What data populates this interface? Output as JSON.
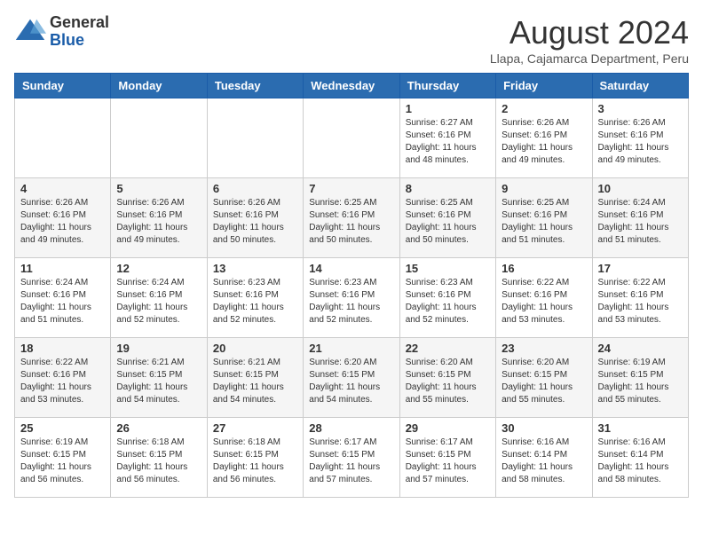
{
  "header": {
    "logo_general": "General",
    "logo_blue": "Blue",
    "month_year": "August 2024",
    "location": "Llapa, Cajamarca Department, Peru"
  },
  "days_of_week": [
    "Sunday",
    "Monday",
    "Tuesday",
    "Wednesday",
    "Thursday",
    "Friday",
    "Saturday"
  ],
  "weeks": [
    [
      {
        "day": "",
        "info": ""
      },
      {
        "day": "",
        "info": ""
      },
      {
        "day": "",
        "info": ""
      },
      {
        "day": "",
        "info": ""
      },
      {
        "day": "1",
        "info": "Sunrise: 6:27 AM\nSunset: 6:16 PM\nDaylight: 11 hours\nand 48 minutes."
      },
      {
        "day": "2",
        "info": "Sunrise: 6:26 AM\nSunset: 6:16 PM\nDaylight: 11 hours\nand 49 minutes."
      },
      {
        "day": "3",
        "info": "Sunrise: 6:26 AM\nSunset: 6:16 PM\nDaylight: 11 hours\nand 49 minutes."
      }
    ],
    [
      {
        "day": "4",
        "info": "Sunrise: 6:26 AM\nSunset: 6:16 PM\nDaylight: 11 hours\nand 49 minutes."
      },
      {
        "day": "5",
        "info": "Sunrise: 6:26 AM\nSunset: 6:16 PM\nDaylight: 11 hours\nand 49 minutes."
      },
      {
        "day": "6",
        "info": "Sunrise: 6:26 AM\nSunset: 6:16 PM\nDaylight: 11 hours\nand 50 minutes."
      },
      {
        "day": "7",
        "info": "Sunrise: 6:25 AM\nSunset: 6:16 PM\nDaylight: 11 hours\nand 50 minutes."
      },
      {
        "day": "8",
        "info": "Sunrise: 6:25 AM\nSunset: 6:16 PM\nDaylight: 11 hours\nand 50 minutes."
      },
      {
        "day": "9",
        "info": "Sunrise: 6:25 AM\nSunset: 6:16 PM\nDaylight: 11 hours\nand 51 minutes."
      },
      {
        "day": "10",
        "info": "Sunrise: 6:24 AM\nSunset: 6:16 PM\nDaylight: 11 hours\nand 51 minutes."
      }
    ],
    [
      {
        "day": "11",
        "info": "Sunrise: 6:24 AM\nSunset: 6:16 PM\nDaylight: 11 hours\nand 51 minutes."
      },
      {
        "day": "12",
        "info": "Sunrise: 6:24 AM\nSunset: 6:16 PM\nDaylight: 11 hours\nand 52 minutes."
      },
      {
        "day": "13",
        "info": "Sunrise: 6:23 AM\nSunset: 6:16 PM\nDaylight: 11 hours\nand 52 minutes."
      },
      {
        "day": "14",
        "info": "Sunrise: 6:23 AM\nSunset: 6:16 PM\nDaylight: 11 hours\nand 52 minutes."
      },
      {
        "day": "15",
        "info": "Sunrise: 6:23 AM\nSunset: 6:16 PM\nDaylight: 11 hours\nand 52 minutes."
      },
      {
        "day": "16",
        "info": "Sunrise: 6:22 AM\nSunset: 6:16 PM\nDaylight: 11 hours\nand 53 minutes."
      },
      {
        "day": "17",
        "info": "Sunrise: 6:22 AM\nSunset: 6:16 PM\nDaylight: 11 hours\nand 53 minutes."
      }
    ],
    [
      {
        "day": "18",
        "info": "Sunrise: 6:22 AM\nSunset: 6:16 PM\nDaylight: 11 hours\nand 53 minutes."
      },
      {
        "day": "19",
        "info": "Sunrise: 6:21 AM\nSunset: 6:15 PM\nDaylight: 11 hours\nand 54 minutes."
      },
      {
        "day": "20",
        "info": "Sunrise: 6:21 AM\nSunset: 6:15 PM\nDaylight: 11 hours\nand 54 minutes."
      },
      {
        "day": "21",
        "info": "Sunrise: 6:20 AM\nSunset: 6:15 PM\nDaylight: 11 hours\nand 54 minutes."
      },
      {
        "day": "22",
        "info": "Sunrise: 6:20 AM\nSunset: 6:15 PM\nDaylight: 11 hours\nand 55 minutes."
      },
      {
        "day": "23",
        "info": "Sunrise: 6:20 AM\nSunset: 6:15 PM\nDaylight: 11 hours\nand 55 minutes."
      },
      {
        "day": "24",
        "info": "Sunrise: 6:19 AM\nSunset: 6:15 PM\nDaylight: 11 hours\nand 55 minutes."
      }
    ],
    [
      {
        "day": "25",
        "info": "Sunrise: 6:19 AM\nSunset: 6:15 PM\nDaylight: 11 hours\nand 56 minutes."
      },
      {
        "day": "26",
        "info": "Sunrise: 6:18 AM\nSunset: 6:15 PM\nDaylight: 11 hours\nand 56 minutes."
      },
      {
        "day": "27",
        "info": "Sunrise: 6:18 AM\nSunset: 6:15 PM\nDaylight: 11 hours\nand 56 minutes."
      },
      {
        "day": "28",
        "info": "Sunrise: 6:17 AM\nSunset: 6:15 PM\nDaylight: 11 hours\nand 57 minutes."
      },
      {
        "day": "29",
        "info": "Sunrise: 6:17 AM\nSunset: 6:15 PM\nDaylight: 11 hours\nand 57 minutes."
      },
      {
        "day": "30",
        "info": "Sunrise: 6:16 AM\nSunset: 6:14 PM\nDaylight: 11 hours\nand 58 minutes."
      },
      {
        "day": "31",
        "info": "Sunrise: 6:16 AM\nSunset: 6:14 PM\nDaylight: 11 hours\nand 58 minutes."
      }
    ]
  ]
}
